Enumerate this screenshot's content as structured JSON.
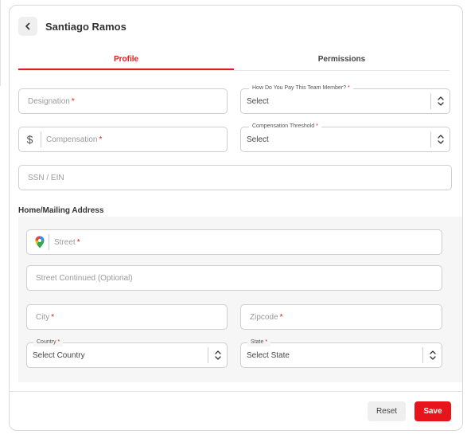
{
  "header": {
    "title": "Santiago Ramos"
  },
  "tabs": [
    {
      "label": "Profile"
    },
    {
      "label": "Permissions"
    }
  ],
  "form": {
    "designation": {
      "placeholder": "Designation",
      "required": "*"
    },
    "pay_method": {
      "label": "How Do You Pay This Team Member?",
      "required": "*",
      "value": "Select"
    },
    "compensation": {
      "currency": "$",
      "placeholder": "Compensation",
      "required": "*"
    },
    "comp_threshold": {
      "label": "Compensation Threshold",
      "required": "*",
      "value": "Select"
    },
    "ssn": {
      "placeholder": "SSN / EIN"
    }
  },
  "address": {
    "title": "Home/Mailing Address",
    "street": {
      "placeholder": "Street",
      "required": "*"
    },
    "street2": {
      "placeholder": "Street Continued (Optional)"
    },
    "city": {
      "placeholder": "City",
      "required": "*"
    },
    "zipcode": {
      "placeholder": "Zipcode",
      "required": "*"
    },
    "country": {
      "label": "Country",
      "required": "*",
      "value": "Select Country"
    },
    "state": {
      "label": "State",
      "required": "*",
      "value": "Select State"
    }
  },
  "footer": {
    "reset_label": "Reset",
    "save_label": "Save"
  },
  "colors": {
    "accent": "#e31b1b"
  }
}
